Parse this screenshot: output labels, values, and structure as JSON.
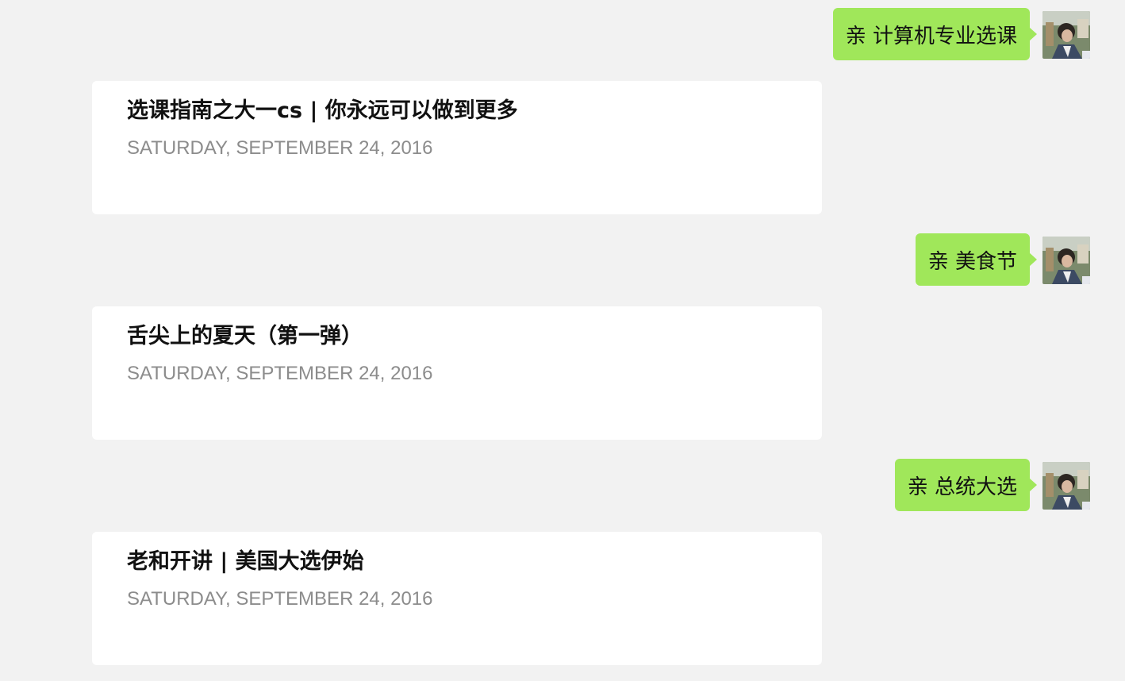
{
  "conversation": [
    {
      "request": "亲 计算机专业选课",
      "reply": {
        "title": "选课指南之大一cs | 你永远可以做到更多",
        "date": "SATURDAY, SEPTEMBER 24, 2016"
      }
    },
    {
      "request": "亲 美食节",
      "reply": {
        "title": "舌尖上的夏天（第一弹）",
        "date": "SATURDAY, SEPTEMBER 24, 2016"
      }
    },
    {
      "request": "亲 总统大选",
      "reply": {
        "title": "老和开讲 | 美国大选伊始",
        "date": "SATURDAY, SEPTEMBER 24, 2016"
      }
    }
  ],
  "icons": {
    "avatar": "user-avatar-icon"
  },
  "colors": {
    "background": "#f2f2f2",
    "bubble": "#a0e75a",
    "card": "#ffffff",
    "date_text": "#8c8c8c"
  }
}
